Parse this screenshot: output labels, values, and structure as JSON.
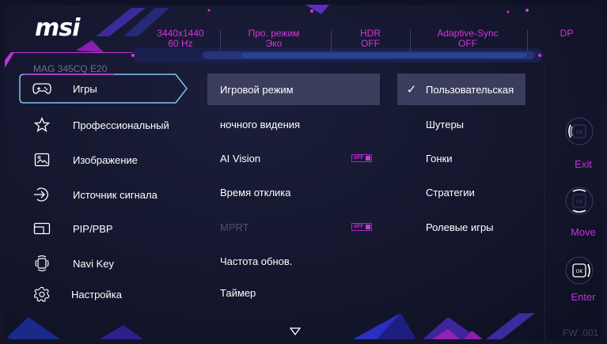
{
  "brand": {
    "logo": "msi",
    "model": "MAG 345CQ E20",
    "firmware": "FW .001"
  },
  "status_bar": [
    {
      "line1": "3440x1440",
      "line2": "60 Hz"
    },
    {
      "line1": "Про. режим",
      "line2": "Эко"
    },
    {
      "line1": "HDR",
      "line2": "OFF"
    },
    {
      "line1": "Adaptive-Sync",
      "line2": "OFF"
    },
    {
      "line1": "DP",
      "line2": ""
    }
  ],
  "menu": [
    {
      "label": "Игры",
      "icon": "gamepad-icon",
      "selected": true
    },
    {
      "label": "Профессиональный",
      "icon": "star-icon"
    },
    {
      "label": "Изображение",
      "icon": "image-icon"
    },
    {
      "label": "Источник сигнала",
      "icon": "input-source-icon"
    },
    {
      "label": "PIP/PBP",
      "icon": "pip-icon"
    },
    {
      "label": "Navi Key",
      "icon": "navi-key-icon"
    },
    {
      "label": "Настройка",
      "icon": "gear-icon"
    }
  ],
  "submenu": [
    {
      "label": "Игровой режим",
      "selected": true
    },
    {
      "label": "ночного видения"
    },
    {
      "label": "AI Vision",
      "toggle": "OFF"
    },
    {
      "label": "Время отклика"
    },
    {
      "label": "MPRT",
      "toggle": "OFF",
      "disabled": true
    },
    {
      "label": "Частота обнов."
    },
    {
      "label": "Таймер"
    }
  ],
  "options": [
    {
      "label": "Пользовательская",
      "selected": true,
      "icon": "checkmark-icon"
    },
    {
      "label": "Шутеры"
    },
    {
      "label": "Гонки"
    },
    {
      "label": "Стратегии"
    },
    {
      "label": "Ролевые игры"
    }
  ],
  "navigation": {
    "exit": "Exit",
    "move": "Move",
    "enter": "Enter"
  },
  "colors": {
    "accent": "#c233d8",
    "selected_bg": "#3a3d5c",
    "menu_outline": "#7ec3f0",
    "background": "#12142a"
  }
}
